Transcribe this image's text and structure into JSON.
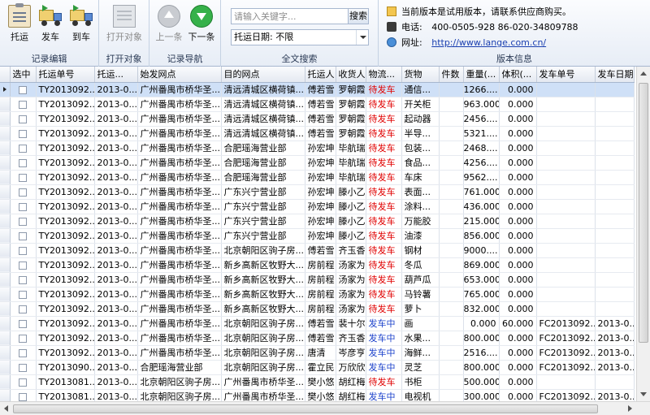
{
  "ribbon": {
    "buttons": {
      "tuoyun": "托运",
      "fache": "发车",
      "daoche": "到车",
      "open_object": "打开对象",
      "prev": "上一条",
      "next": "下一条"
    },
    "groups": {
      "edit": "记录编辑",
      "open": "打开对象",
      "nav": "记录导航",
      "search": "全文搜索",
      "version": "版本信息"
    },
    "search": {
      "placeholder": "请输入关键字...",
      "button": "搜索",
      "date_filter": "托运日期: 不限"
    },
    "info": {
      "notice": "当前版本是试用版本，请联系供应商购买。",
      "phone_label": "电话:",
      "phone": "400-0505-928   86-020-34809788",
      "site_label": "网址:",
      "site": "http://www.lange.com.cn/"
    }
  },
  "grid": {
    "columns": [
      "选中",
      "托运单号",
      "托运...",
      "始发网点",
      "目的网点",
      "托运人",
      "收货人",
      "物流...",
      "货物",
      "件数",
      "重量(...",
      "体积(...",
      "发车单号",
      "发车日期"
    ],
    "rows": [
      [
        "TY2013092...",
        "2013-0...",
        "广州番禺市桥华圣...",
        "清远清城区横荷镇...",
        "傅若雪",
        "罗朝霞",
        "待发车",
        "通信...",
        "",
        "1266....",
        "0.000",
        "",
        ""
      ],
      [
        "TY2013092...",
        "2013-0...",
        "广州番禺市桥华圣...",
        "清远清城区横荷镇...",
        "傅若雪",
        "罗朝霞",
        "待发车",
        "开关柜",
        "",
        "963.000",
        "0.000",
        "",
        ""
      ],
      [
        "TY2013092...",
        "2013-0...",
        "广州番禺市桥华圣...",
        "清远清城区横荷镇...",
        "傅若雪",
        "罗朝霞",
        "待发车",
        "起动器",
        "",
        "2456....",
        "0.000",
        "",
        ""
      ],
      [
        "TY2013092...",
        "2013-0...",
        "广州番禺市桥华圣...",
        "清远清城区横荷镇...",
        "傅若雪",
        "罗朝霞",
        "待发车",
        "半导...",
        "",
        "5321....",
        "0.000",
        "",
        ""
      ],
      [
        "TY2013092...",
        "2013-0...",
        "广州番禺市桥华圣...",
        "合肥瑶海营业部",
        "孙宏坤",
        "毕航瑞",
        "待发车",
        "包装...",
        "",
        "2468....",
        "0.000",
        "",
        ""
      ],
      [
        "TY2013092...",
        "2013-0...",
        "广州番禺市桥华圣...",
        "合肥瑶海营业部",
        "孙宏坤",
        "毕航瑞",
        "待发车",
        "食品...",
        "",
        "4256....",
        "0.000",
        "",
        ""
      ],
      [
        "TY2013092...",
        "2013-0...",
        "广州番禺市桥华圣...",
        "合肥瑶海营业部",
        "孙宏坤",
        "毕航瑞",
        "待发车",
        "车床",
        "",
        "9562....",
        "0.000",
        "",
        ""
      ],
      [
        "TY2013092...",
        "2013-0...",
        "广州番禺市桥华圣...",
        "广东兴宁营业部",
        "孙宏坤",
        "滕小乙",
        "待发车",
        "表面...",
        "",
        "761.000",
        "0.000",
        "",
        ""
      ],
      [
        "TY2013092...",
        "2013-0...",
        "广州番禺市桥华圣...",
        "广东兴宁营业部",
        "孙宏坤",
        "滕小乙",
        "待发车",
        "涂料...",
        "",
        "436.000",
        "0.000",
        "",
        ""
      ],
      [
        "TY2013092...",
        "2013-0...",
        "广州番禺市桥华圣...",
        "广东兴宁营业部",
        "孙宏坤",
        "滕小乙",
        "待发车",
        "万能胶",
        "",
        "215.000",
        "0.000",
        "",
        ""
      ],
      [
        "TY2013092...",
        "2013-0...",
        "广州番禺市桥华圣...",
        "广东兴宁营业部",
        "孙宏坤",
        "滕小乙",
        "待发车",
        "油漆",
        "",
        "856.000",
        "0.000",
        "",
        ""
      ],
      [
        "TY2013092...",
        "2013-0...",
        "广州番禺市桥华圣...",
        "北京朝阳区驹子房...",
        "傅若雪",
        "齐玉香",
        "待发车",
        "钢材",
        "",
        "9000....",
        "0.000",
        "",
        ""
      ],
      [
        "TY2013092...",
        "2013-0...",
        "广州番禺市桥华圣...",
        "新乡高新区牧野大...",
        "房前程",
        "汤家为",
        "待发车",
        "冬瓜",
        "",
        "869.000",
        "0.000",
        "",
        ""
      ],
      [
        "TY2013092...",
        "2013-0...",
        "广州番禺市桥华圣...",
        "新乡高新区牧野大...",
        "房前程",
        "汤家为",
        "待发车",
        "葫芦瓜",
        "",
        "653.000",
        "0.000",
        "",
        ""
      ],
      [
        "TY2013092...",
        "2013-0...",
        "广州番禺市桥华圣...",
        "新乡高新区牧野大...",
        "房前程",
        "汤家为",
        "待发车",
        "马铃薯",
        "",
        "765.000",
        "0.000",
        "",
        ""
      ],
      [
        "TY2013092...",
        "2013-0...",
        "广州番禺市桥华圣...",
        "新乡高新区牧野大...",
        "房前程",
        "汤家为",
        "待发车",
        "萝卜",
        "",
        "832.000",
        "0.000",
        "",
        ""
      ],
      [
        "TY2013092...",
        "2013-0...",
        "广州番禺市桥华圣...",
        "北京朝阳区驹子房...",
        "傅若雪",
        "裴十尔",
        "发车中",
        "画",
        "",
        "0.000",
        "60.000",
        "FC2013092...",
        "2013-0..."
      ],
      [
        "TY2013092...",
        "2013-0...",
        "广州番禺市桥华圣...",
        "北京朝阳区驹子房...",
        "傅若雪",
        "齐玉香",
        "发车中",
        "水果...",
        "",
        "800.000",
        "0.000",
        "FC2013092...",
        "2013-0..."
      ],
      [
        "TY2013092...",
        "2013-0...",
        "广州番禺市桥华圣...",
        "北京朝阳区驹子房...",
        "唐清",
        "岑彦亨",
        "发车中",
        "海鲜...",
        "",
        "2516....",
        "0.000",
        "FC2013092...",
        "2013-0..."
      ],
      [
        "TY2013090...",
        "2013-0...",
        "合肥瑶海营业部",
        "北京朝阳区驹子房...",
        "霍立民",
        "万欣欣",
        "发车中",
        "灵芝",
        "",
        "800.000",
        "0.000",
        "FC2013092...",
        "2013-0..."
      ],
      [
        "TY2013081...",
        "2013-0...",
        "北京朝阳区驹子房...",
        "广州番禺市桥华圣...",
        "樊小悠",
        "胡红梅",
        "待发车",
        "书柜",
        "",
        "500.000",
        "0.000",
        "",
        ""
      ],
      [
        "TY2013081...",
        "2013-0...",
        "北京朝阳区驹子房...",
        "广州番禺市桥华圣...",
        "樊小悠",
        "胡红梅",
        "发车中",
        "电视机",
        "",
        "300.000",
        "0.000",
        "FC2013092...",
        "2013-0..."
      ]
    ]
  },
  "colors": {
    "status_waiting": "#e00000",
    "status_in_transit": "#1f44cc",
    "selected_row": "#cfe0f7"
  }
}
